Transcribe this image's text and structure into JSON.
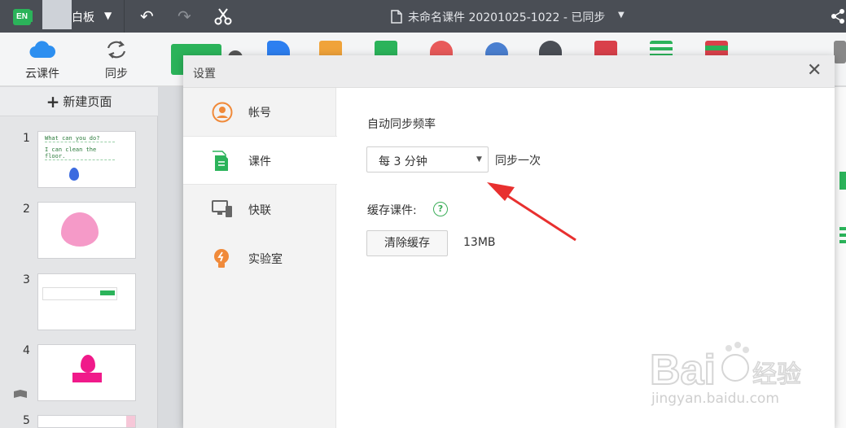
{
  "titlebar": {
    "logo_text": "EN",
    "tab_label": "白板",
    "doc_title": "未命名课件 20201025-1022 - 已同步"
  },
  "toolbar": {
    "cloud_label": "云课件",
    "sync_label": "同步"
  },
  "pages": {
    "new_page_label": "新建页面",
    "slides": [
      {
        "num": "1",
        "text_line1": "What can you do?",
        "text_line2": "I can clean the floor."
      },
      {
        "num": "2"
      },
      {
        "num": "3"
      },
      {
        "num": "4"
      },
      {
        "num": "5"
      }
    ]
  },
  "dialog": {
    "title": "设置",
    "nav": [
      {
        "label": "帐号",
        "icon": "user-icon"
      },
      {
        "label": "课件",
        "icon": "document-icon"
      },
      {
        "label": "快联",
        "icon": "monitor-icon"
      },
      {
        "label": "实验室",
        "icon": "lightbulb-icon"
      }
    ],
    "active_nav": "课件",
    "sync_freq_label": "自动同步频率",
    "sync_select_value": "每 3 分钟",
    "sync_suffix": "同步一次",
    "cache_label": "缓存课件:",
    "help_glyph": "?",
    "clear_cache_button": "清除缓存",
    "cache_size": "13MB"
  },
  "watermark": {
    "brand": "Bai 经验",
    "url": "jingyan.baidu.com"
  },
  "colors": {
    "accent_green": "#2bb35a",
    "arrow_red": "#e8302f",
    "titlebar_bg": "#4a4e55"
  }
}
